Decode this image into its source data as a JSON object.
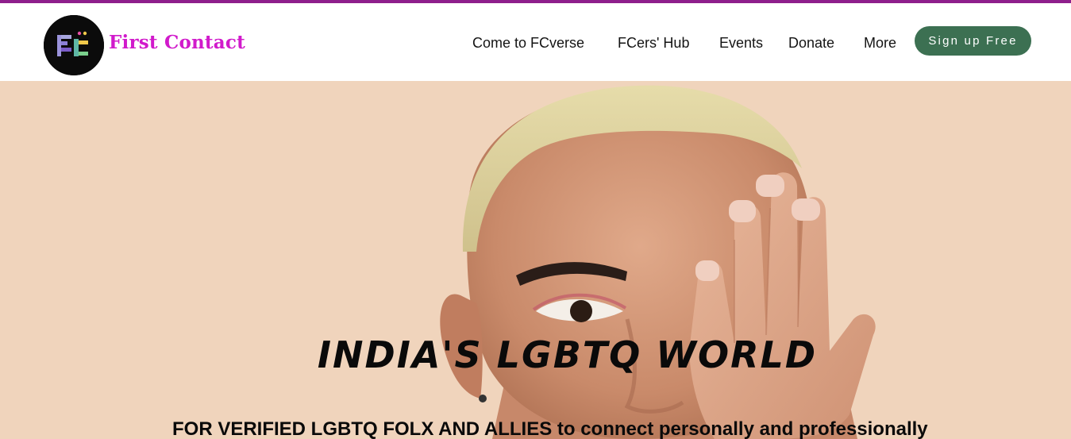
{
  "brand": {
    "name": "First Contact",
    "logo_icon": "fc-monogram-logo",
    "color": "#d11acb"
  },
  "nav": {
    "items": [
      {
        "label": "Come to FCverse"
      },
      {
        "label": "FCers' Hub"
      },
      {
        "label": "Events"
      },
      {
        "label": "Donate"
      },
      {
        "label": "More"
      }
    ],
    "cta_label": "Sign up Free",
    "cta_color": "#3c7052"
  },
  "hero": {
    "headline": "INDIA'S LGBTQ WORLD",
    "subline": "FOR VERIFIED LGBTQ FOLX AND ALLIES to connect personally and professionally",
    "background_color": "#f0d4bc",
    "image": "person-covering-eye-photo"
  },
  "accent": {
    "top_border": "#8e1f8c"
  }
}
